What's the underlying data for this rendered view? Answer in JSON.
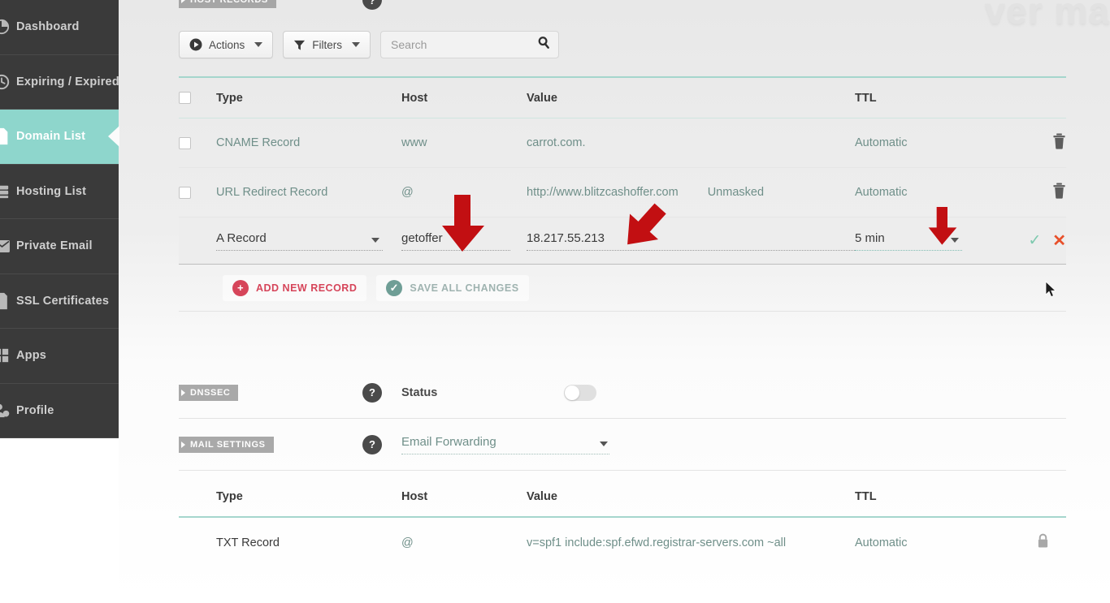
{
  "watermark": {
    "text": "ver ma"
  },
  "sidebar": {
    "items": [
      {
        "label": "Dashboard",
        "icon": "gauge-icon",
        "active": false
      },
      {
        "label": "Expiring / Expired",
        "icon": "clock-icon",
        "active": false
      },
      {
        "label": "Domain List",
        "icon": "page-icon",
        "active": true
      },
      {
        "label": "Hosting List",
        "icon": "server-icon",
        "active": false
      },
      {
        "label": "Private Email",
        "icon": "envelope-icon",
        "active": false
      },
      {
        "label": "SSL Certificates",
        "icon": "certificate-icon",
        "active": false
      },
      {
        "label": "Apps",
        "icon": "grid-icon",
        "active": false
      },
      {
        "label": "Profile",
        "icon": "person-gear-icon",
        "active": false
      }
    ]
  },
  "host_records": {
    "section_chip": "HOST RECORDS",
    "toolbar": {
      "actions_label": "Actions",
      "filters_label": "Filters",
      "search_placeholder": "Search",
      "search_value": ""
    },
    "columns": [
      "Type",
      "Host",
      "Value",
      "TTL"
    ],
    "rows": [
      {
        "type": "CNAME Record",
        "host": "www",
        "value": "carrot.com.",
        "extra": "",
        "ttl": "Automatic",
        "action_icon": "trash-icon",
        "editing": false
      },
      {
        "type": "URL Redirect Record",
        "host": "@",
        "value": "http://www.blitzcashoffer.com",
        "extra": "Unmasked",
        "ttl": "Automatic",
        "action_icon": "trash-icon",
        "editing": false
      }
    ],
    "edit_row": {
      "type": "A Record",
      "host": "getoffer",
      "value": "18.217.55.213",
      "ttl": "5 min",
      "confirm_icon": "check-icon",
      "cancel_icon": "close-icon"
    },
    "buttons": {
      "add_label": "ADD NEW RECORD",
      "save_label": "SAVE ALL CHANGES"
    }
  },
  "dnssec": {
    "chip": "DNSSEC",
    "help": "?",
    "status_label": "Status",
    "status_on": false
  },
  "mail_settings": {
    "chip": "MAIL SETTINGS",
    "help": "?",
    "selected": "Email Forwarding"
  },
  "mail_table": {
    "columns": [
      "Type",
      "Host",
      "Value",
      "TTL"
    ],
    "rows": [
      {
        "type": "TXT Record",
        "host": "@",
        "value": "v=spf1 include:spf.efwd.registrar-servers.com ~all",
        "ttl": "Automatic",
        "action_icon": "lock-icon"
      }
    ]
  },
  "annotations": {
    "arrow_color": "#c20f12",
    "arrows": [
      {
        "name": "arrow-host-field",
        "points": "down"
      },
      {
        "name": "arrow-value-field",
        "points": "down-left"
      },
      {
        "name": "arrow-ttl-field",
        "points": "down"
      }
    ],
    "cursor": "mouse-pointer"
  },
  "colors": {
    "accent_teal": "#8ed6cc",
    "sidebar_bg": "#3a3a3a",
    "add_red": "#d6455a",
    "cancel_red": "#e8502a",
    "confirm_green": "#7dc9ae"
  }
}
